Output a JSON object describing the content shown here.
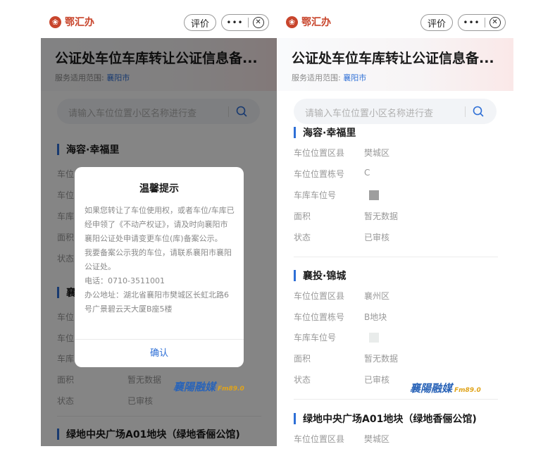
{
  "left": {
    "brand": "鄂汇办",
    "rate_label": "评价",
    "dots": "•••",
    "title": "公证处车位车库转让公证信息备...",
    "scope_label": "服务适用范围:",
    "scope_city": "襄阳市",
    "search_placeholder": "请输入车位位置小区名称进行查",
    "section1_title": "海容·幸福里",
    "row_labels_partial": [
      "车位",
      "车位",
      "车库",
      "面积",
      "状态"
    ],
    "section2_title_partial": "襄",
    "row_labels2_partial": [
      "车位",
      "车位",
      "车库"
    ],
    "area_label": "面积",
    "area_value": "暂无数据",
    "status_label": "状态",
    "status_value": "已审核",
    "section3_title": "绿地中央广场A01地块（绿地香俪公馆)"
  },
  "modal": {
    "title": "温馨提示",
    "para1": "如果您转让了车位使用权，或者车位/车库已经申领了《不动产权证》，请及时向襄阳市襄阳公证处申请变更车位(库)备案公示。",
    "para2": "我要备案公示我的车位，请联系襄阳市襄阳公证处。",
    "phone": "电话：0710-3511001",
    "address": "办公地址：湖北省襄阳市樊城区长虹北路6号广景碧云天大厦B座5楼",
    "confirm": "确认"
  },
  "right": {
    "brand": "鄂汇办",
    "rate_label": "评价",
    "dots": "•••",
    "title": "公证处车位车库转让公证信息备...",
    "scope_label": "服务适用范围:",
    "scope_city": "襄阳市",
    "search_placeholder": "请输入车位位置小区名称进行查",
    "s1": {
      "title": "海容·幸福里",
      "district_label": "车位位置区县",
      "district_value": "樊城区",
      "building_label": "车位位置栋号",
      "building_value": "C",
      "space_label": "车库车位号",
      "area_label": "面积",
      "area_value": "暂无数据",
      "status_label": "状态",
      "status_value": "已审核"
    },
    "s2": {
      "title": "襄投·锦城",
      "district_label": "车位位置区县",
      "district_value": "襄州区",
      "building_label": "车位位置栋号",
      "building_value": "B地块",
      "space_label": "车库车位号",
      "area_label": "面积",
      "area_value": "暂无数据",
      "status_label": "状态",
      "status_value": "已审核"
    },
    "s3": {
      "title": "绿地中央广场A01地块（绿地香俪公馆)",
      "district_label": "车位位置区县",
      "district_value": "樊城区"
    }
  },
  "watermark": {
    "text": "襄陽融媒",
    "sub": "Fm89.0"
  },
  "colors": {
    "accent": "#2e6fd6",
    "brand": "#c8452c"
  }
}
